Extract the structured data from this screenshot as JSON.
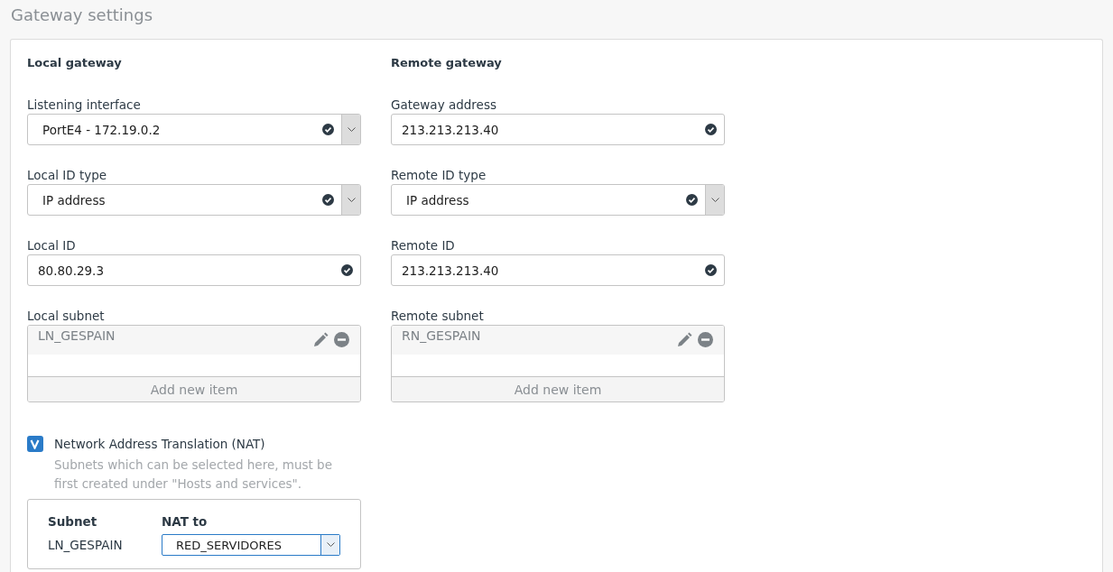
{
  "page_title": "Gateway settings",
  "columns": [
    {
      "heading": "Local gateway",
      "fields": [
        {
          "kind": "select",
          "label": "Listening interface",
          "value": "PortE4 - 172.19.0.2",
          "valid": true
        },
        {
          "kind": "select",
          "label": "Local ID type",
          "value": "IP address",
          "valid": true
        },
        {
          "kind": "text",
          "label": "Local ID",
          "value": "80.80.29.3",
          "valid": true
        },
        {
          "kind": "list",
          "label": "Local subnet",
          "items": [
            "LN_GESPAIN"
          ],
          "add_label": "Add new item"
        }
      ]
    },
    {
      "heading": "Remote gateway",
      "fields": [
        {
          "kind": "text",
          "label": "Gateway address",
          "value": "213.213.213.40",
          "valid": true
        },
        {
          "kind": "select",
          "label": "Remote ID type",
          "value": "IP address",
          "valid": true
        },
        {
          "kind": "text",
          "label": "Remote ID",
          "value": "213.213.213.40",
          "valid": true
        },
        {
          "kind": "list",
          "label": "Remote subnet",
          "items": [
            "RN_GESPAIN"
          ],
          "add_label": "Add new item"
        }
      ]
    }
  ],
  "nat": {
    "label": "Network Address Translation (NAT)",
    "checked": true,
    "help": "Subnets which can be selected here, must be first created under \"Hosts and services\".",
    "table": {
      "columns": [
        "Subnet",
        "NAT to"
      ],
      "rows": [
        {
          "subnet": "LN_GESPAIN",
          "nat_to": "RED_SERVIDORES"
        }
      ]
    }
  }
}
